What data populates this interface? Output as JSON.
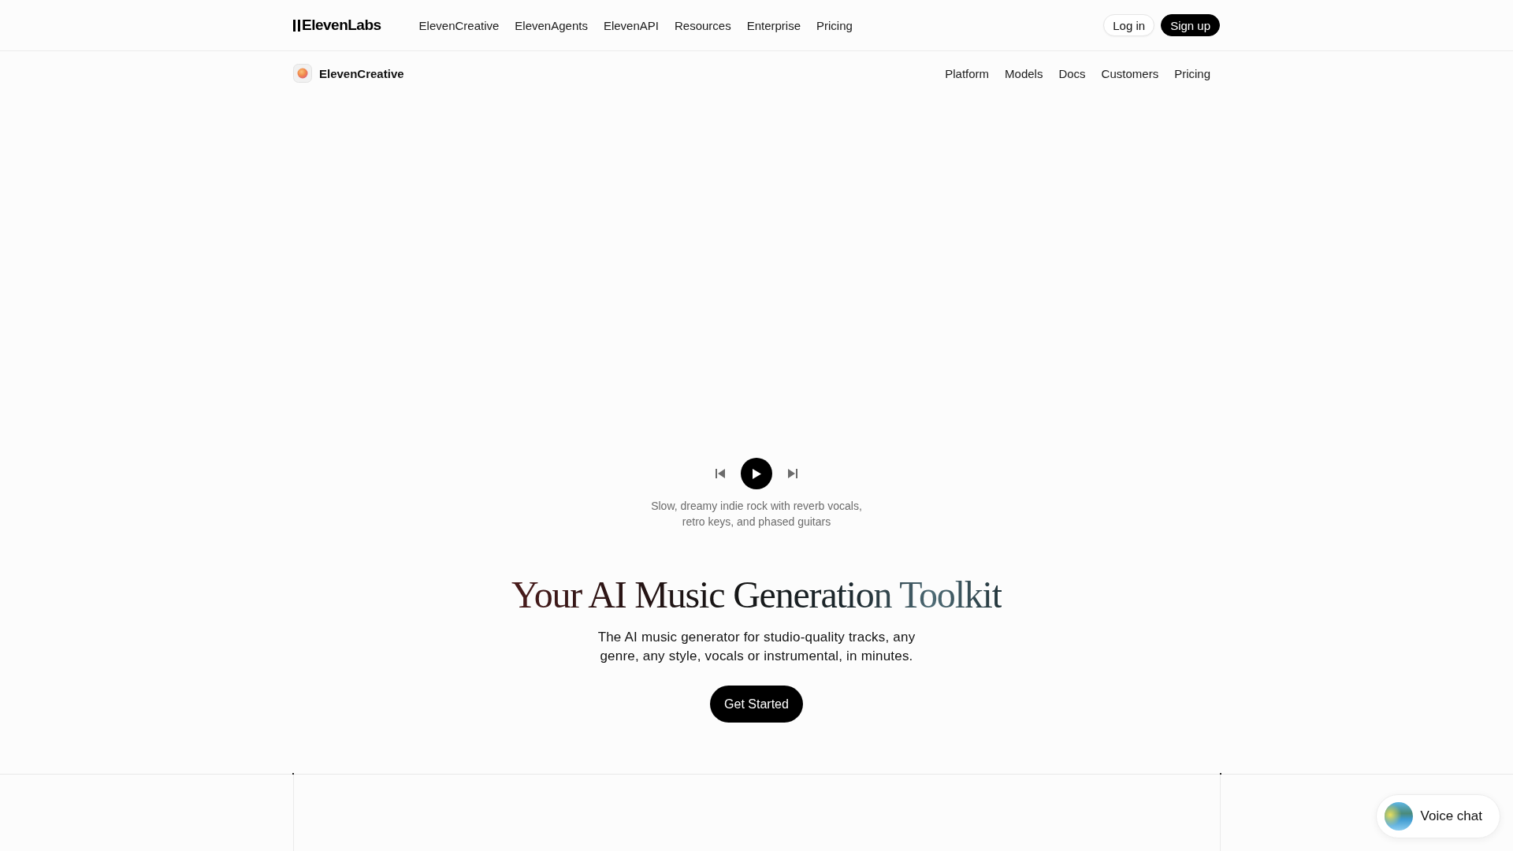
{
  "top_nav": {
    "logo": "ElevenLabs",
    "links": [
      "ElevenCreative",
      "ElevenAgents",
      "ElevenAPI",
      "Resources",
      "Enterprise",
      "Pricing"
    ],
    "buttons": [
      {
        "label": "Log in",
        "kind": "secondary"
      },
      {
        "label": "Sign up",
        "kind": "primary"
      }
    ]
  },
  "sub_nav": {
    "title": "ElevenCreative",
    "links": [
      "Platform",
      "Models",
      "Docs",
      "Customers",
      "Pricing"
    ]
  },
  "player": {
    "caption": "Slow, dreamy indie rock with reverb vocals, retro keys, and phased guitars"
  },
  "hero": {
    "title": "Your AI Music Generation Toolkit",
    "subtitle": "The AI music generator for studio-quality tracks, any genre, any style, vocals or instrumental, in minutes.",
    "cta": "Get Started"
  },
  "voice_chat": {
    "label": "Voice chat"
  }
}
